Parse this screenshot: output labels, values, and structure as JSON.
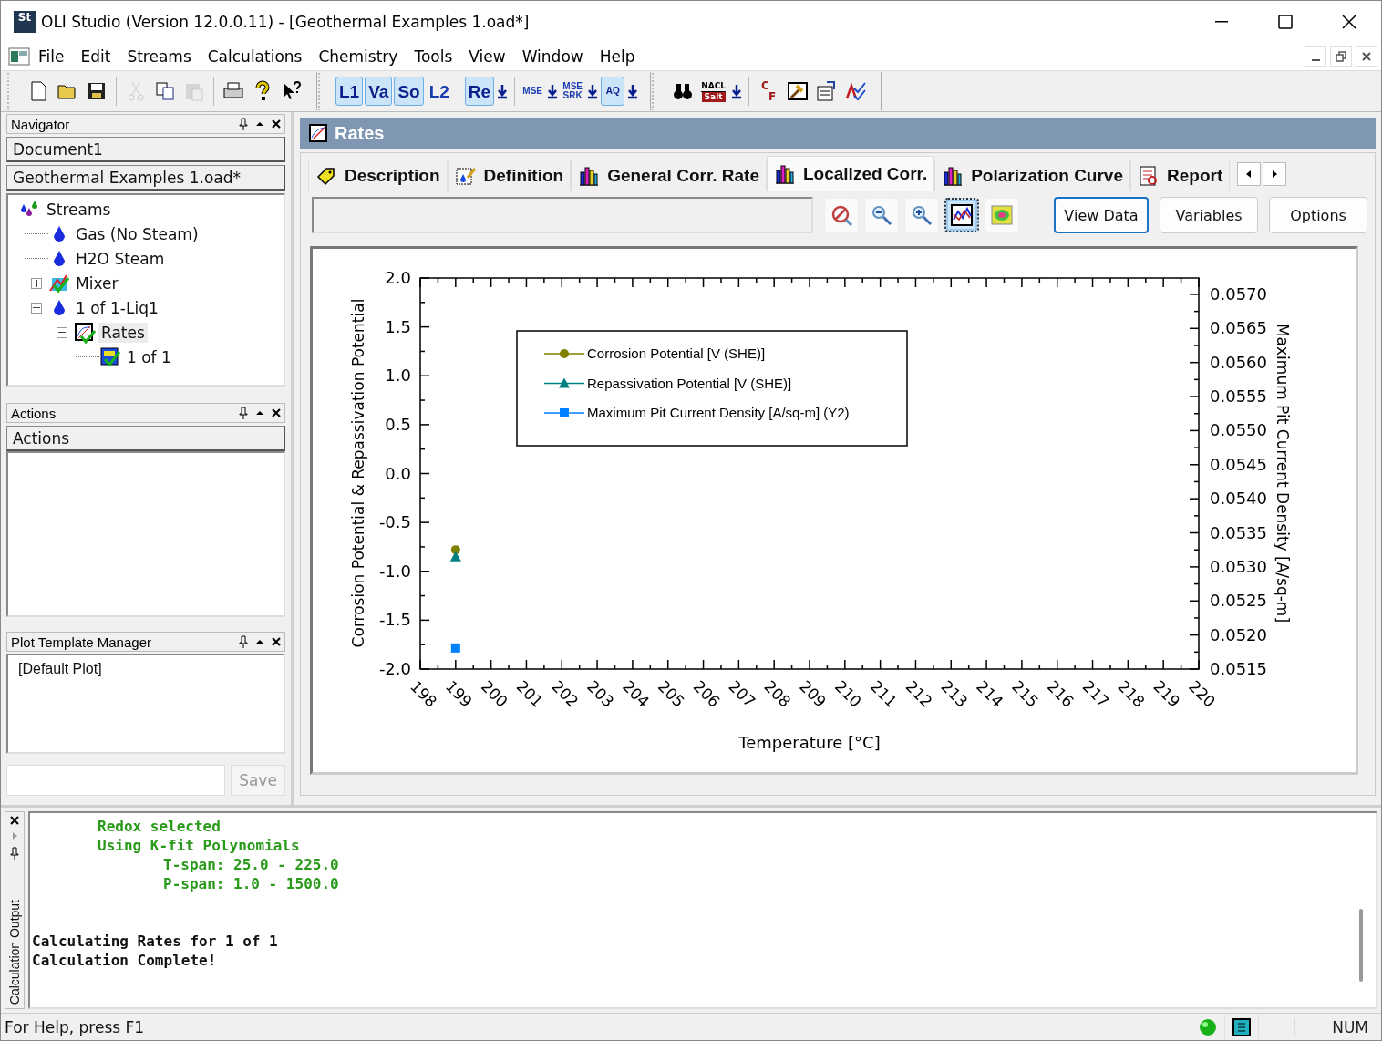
{
  "window": {
    "title": "OLI Studio (Version 12.0.0.11) - [Geothermal Examples 1.oad*]",
    "app_badge": "St"
  },
  "menu": [
    {
      "label": "File"
    },
    {
      "label": "Edit"
    },
    {
      "label": "Streams"
    },
    {
      "label": "Calculations"
    },
    {
      "label": "Chemistry"
    },
    {
      "label": "Tools"
    },
    {
      "label": "View"
    },
    {
      "label": "Window"
    },
    {
      "label": "Help"
    }
  ],
  "toolbars": [
    {
      "groups": [
        [
          {
            "kind": "new",
            "disabled": false
          },
          {
            "kind": "open",
            "disabled": false
          },
          {
            "kind": "save",
            "disabled": false
          }
        ],
        [
          {
            "kind": "cut",
            "disabled": true
          },
          {
            "kind": "copy",
            "disabled": false
          },
          {
            "kind": "paste",
            "disabled": true
          }
        ],
        [
          {
            "kind": "print",
            "disabled": false
          },
          {
            "kind": "help",
            "disabled": false
          },
          {
            "kind": "context-help",
            "disabled": false
          }
        ]
      ]
    },
    {
      "groups": [
        [
          {
            "kind": "text",
            "label": "L1",
            "selected": true
          },
          {
            "kind": "text",
            "label": "Va",
            "selected": true
          },
          {
            "kind": "text",
            "label": "So",
            "selected": true
          },
          {
            "kind": "text",
            "label": "L2",
            "selected": false
          }
        ],
        [
          {
            "kind": "text",
            "label": "Re",
            "selected": true
          },
          {
            "kind": "arrow"
          }
        ],
        [
          {
            "kind": "small",
            "label": "MSE",
            "selected": false
          },
          {
            "kind": "arrow"
          },
          {
            "kind": "small",
            "label": "MSE SRK",
            "selected": false
          },
          {
            "kind": "arrow"
          },
          {
            "kind": "small",
            "label": "AQ",
            "selected": true
          },
          {
            "kind": "arrow"
          }
        ]
      ]
    },
    {
      "groups": [
        [
          {
            "kind": "find"
          },
          {
            "kind": "salt",
            "label": "NACL",
            "sub": "Salt"
          },
          {
            "kind": "arrow"
          }
        ],
        [
          {
            "kind": "convert",
            "label": "C",
            "sub": "F"
          },
          {
            "kind": "plot"
          },
          {
            "kind": "properties"
          },
          {
            "kind": "check"
          }
        ]
      ]
    }
  ],
  "navigator": {
    "title": "Navigator",
    "documents": [
      "Document1",
      "Geothermal Examples 1.oad*"
    ],
    "tree": [
      {
        "label": "Streams",
        "kind": "streams",
        "selected": false,
        "children": [
          {
            "label": "Gas (No Steam)",
            "kind": "drop",
            "selected": false
          },
          {
            "label": "H2O Steam",
            "kind": "drop",
            "selected": false
          },
          {
            "label": "Mixer",
            "kind": "mixer",
            "selected": false,
            "expanded": false
          },
          {
            "label": "1 of 1-Liq1",
            "kind": "drop",
            "selected": false,
            "expanded": true,
            "children": [
              {
                "label": "Rates",
                "kind": "rates",
                "selected": true,
                "expanded": true,
                "children": [
                  {
                    "label": "1 of 1",
                    "kind": "result",
                    "selected": false
                  }
                ]
              }
            ]
          }
        ]
      }
    ]
  },
  "actions": {
    "title": "Actions",
    "header": "Actions"
  },
  "plot_templates": {
    "title": "Plot Template Manager",
    "items": [
      "[Default Plot]"
    ],
    "save_label": "Save"
  },
  "document": {
    "title": "Rates",
    "tabs": [
      {
        "label": "Description",
        "kind": "tag",
        "selected": false
      },
      {
        "label": "Definition",
        "kind": "definition",
        "selected": false
      },
      {
        "label": "General Corr. Rate",
        "kind": "bars",
        "selected": false
      },
      {
        "label": "Localized Corr.",
        "kind": "bars",
        "selected": true
      },
      {
        "label": "Polarization Curve",
        "kind": "bars",
        "selected": false
      },
      {
        "label": "Report",
        "kind": "report",
        "selected": false
      }
    ],
    "tools": [
      {
        "kind": "clear",
        "selected": false
      },
      {
        "kind": "zoom-out",
        "selected": false
      },
      {
        "kind": "zoom-in",
        "selected": false
      },
      {
        "kind": "chart",
        "selected": true
      },
      {
        "kind": "colormap",
        "selected": false
      }
    ],
    "buttons": [
      {
        "label": "View Data",
        "selected": true
      },
      {
        "label": "Variables",
        "selected": false
      },
      {
        "label": "Options",
        "selected": false
      }
    ],
    "chart_data": {
      "type": "scatter",
      "legend": true,
      "xlabel": "Temperature [°C]",
      "ylabel": "Corrosion Potential & Repassivation Potential",
      "y2label": "Maximum Pit Current Density [A/sq-m]",
      "x": [
        199
      ],
      "series": [
        {
          "name": "Corrosion Potential [V (SHE)]",
          "color": "#808000",
          "marker": "circle",
          "axis": "y",
          "values": [
            -0.78
          ]
        },
        {
          "name": "Repassivation Potential [V (SHE)]",
          "color": "#008080",
          "marker": "triangle",
          "axis": "y",
          "values": [
            -0.85
          ]
        },
        {
          "name": "Maximum Pit Current Density [A/sq-m] (Y2)",
          "color": "#0080ff",
          "marker": "square",
          "axis": "y2",
          "values": [
            0.05181
          ]
        }
      ],
      "xlim": [
        198,
        220
      ],
      "ylim": [
        -2,
        2
      ],
      "y2lim": [
        0.0515,
        0.05724
      ],
      "xticks": [
        198,
        199,
        200,
        201,
        202,
        203,
        204,
        205,
        206,
        207,
        208,
        209,
        210,
        211,
        212,
        213,
        214,
        215,
        216,
        217,
        218,
        219,
        220
      ],
      "yticks": [
        {
          "value": -2,
          "label": "-2.0"
        },
        {
          "value": -1.5,
          "label": "-1.5"
        },
        {
          "value": -1,
          "label": "-1.0"
        },
        {
          "value": -0.5,
          "label": "-0.5"
        },
        {
          "value": 0,
          "label": "0.0"
        },
        {
          "value": 0.5,
          "label": "0.5"
        },
        {
          "value": 1,
          "label": "1.0"
        },
        {
          "value": 1.5,
          "label": "1.5"
        },
        {
          "value": 2,
          "label": "2.0"
        }
      ],
      "y2ticks": [
        {
          "value": 0.0515,
          "label": "0.0515"
        },
        {
          "value": 0.052,
          "label": "0.0520"
        },
        {
          "value": 0.0525,
          "label": "0.0525"
        },
        {
          "value": 0.053,
          "label": "0.0530"
        },
        {
          "value": 0.0535,
          "label": "0.0535"
        },
        {
          "value": 0.054,
          "label": "0.0540"
        },
        {
          "value": 0.0545,
          "label": "0.0545"
        },
        {
          "value": 0.055,
          "label": "0.0550"
        },
        {
          "value": 0.0555,
          "label": "0.0555"
        },
        {
          "value": 0.056,
          "label": "0.0560"
        },
        {
          "value": 0.0565,
          "label": "0.0565"
        },
        {
          "value": 0.057,
          "label": "0.0570"
        }
      ]
    }
  },
  "output": {
    "title": "Calculation Output",
    "lines": [
      {
        "kind": "note",
        "text": "Redox selected"
      },
      {
        "kind": "note",
        "text": "Using K-fit Polynomials"
      },
      {
        "kind": "subnote",
        "text": "T-span: 25.0 - 225.0"
      },
      {
        "kind": "subnote",
        "text": "P-span: 1.0 - 1500.0"
      },
      {
        "kind": "status",
        "text": "Calculating Rates for 1 of 1"
      },
      {
        "kind": "status",
        "text": "Calculation Complete!"
      }
    ]
  },
  "status_bar": {
    "text": "For Help, press F1",
    "indicator": "NUM"
  }
}
